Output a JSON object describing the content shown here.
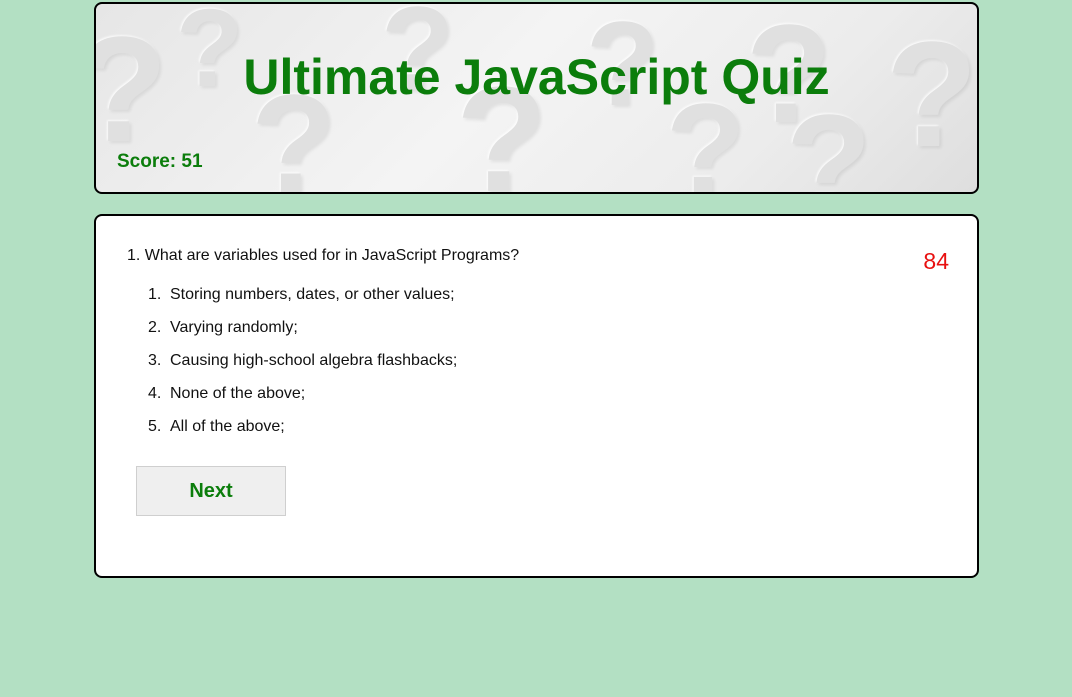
{
  "header": {
    "title": "Ultimate JavaScript Quiz",
    "score_label": "Score: 51"
  },
  "quiz": {
    "question": "1. What are variables used for in JavaScript Programs?",
    "timer": "84",
    "options": [
      {
        "num": "1.",
        "text": "Storing numbers, dates, or other values;"
      },
      {
        "num": "2.",
        "text": "Varying randomly;"
      },
      {
        "num": "3.",
        "text": "Causing high-school algebra flashbacks;"
      },
      {
        "num": "4.",
        "text": "None of the above;"
      },
      {
        "num": "5.",
        "text": "All of the above;"
      }
    ],
    "next_label": "Next"
  },
  "colors": {
    "page_background": "#b3e0c3",
    "accent_green": "#0b7d0b",
    "timer_red": "#e81010"
  }
}
